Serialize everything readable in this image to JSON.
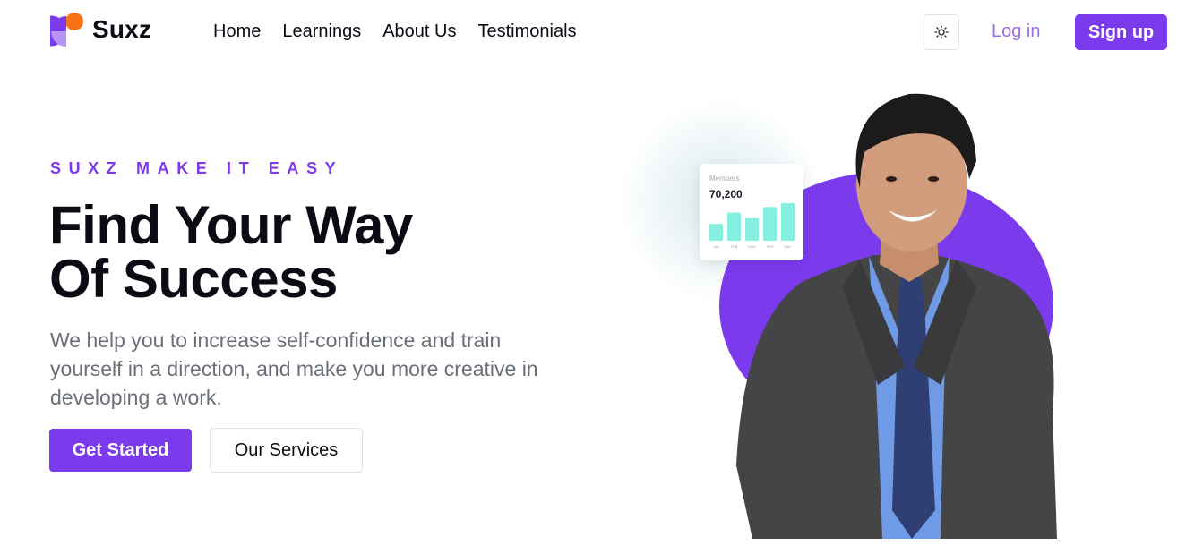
{
  "brand": {
    "name": "Suxz",
    "accent": "#7c3aed",
    "logo_colors": [
      "#f97316",
      "#7c3aed",
      "#b794f4"
    ]
  },
  "nav": {
    "items": [
      {
        "label": "Home"
      },
      {
        "label": "Learnings"
      },
      {
        "label": "About Us"
      },
      {
        "label": "Testimonials"
      }
    ],
    "theme_toggle_icon": "sun-icon",
    "login_label": "Log in",
    "signup_label": "Sign up"
  },
  "hero": {
    "eyebrow": "SUXZ MAKE IT EASY",
    "headline_line1": "Find Your Way",
    "headline_line2": "Of Success",
    "description": "We help you to increase self-confidence and train yourself in a direction, and make you more creative in developing a work.",
    "primary_cta": "Get Started",
    "secondary_cta": "Our Services"
  },
  "stats_card": {
    "title": "Members",
    "value": "70,200",
    "chart_data": {
      "type": "bar",
      "categories": [
        "JAN",
        "FEB",
        "MAR",
        "APR",
        "MAY"
      ],
      "values": [
        18,
        30,
        24,
        36,
        40
      ],
      "color": "#86efe0"
    }
  }
}
